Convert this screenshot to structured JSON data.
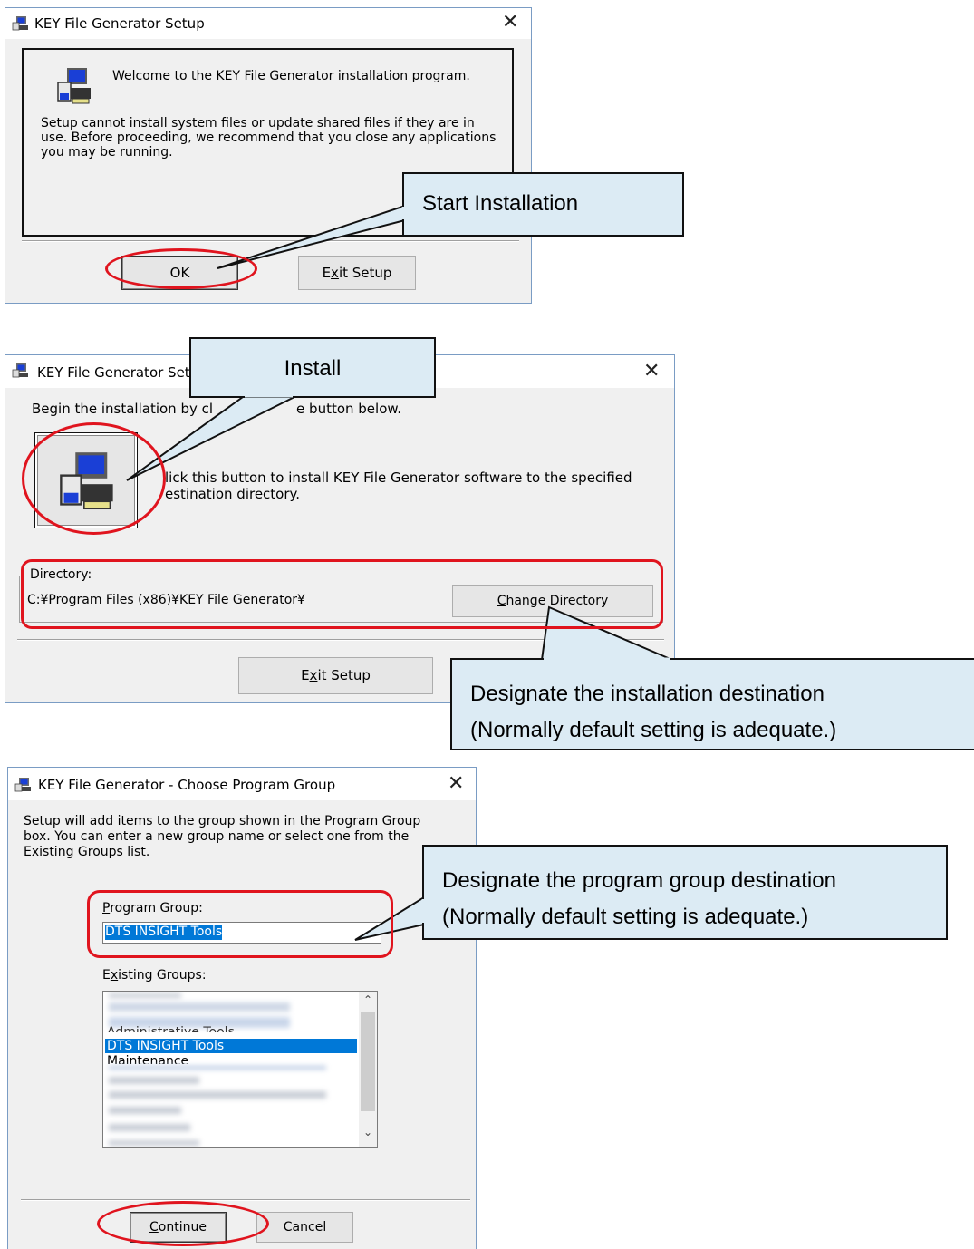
{
  "dialog1": {
    "title": "KEY File Generator Setup",
    "close_glyph": "✕",
    "welcome": "Welcome to the KEY File Generator installation program.",
    "message_lines": [
      "Setup cannot install system files or update shared files if they are in",
      "use. Before proceeding, we recommend that you close any applications",
      "you may be running."
    ],
    "ok_button": "OK",
    "exit_button_pre": "E",
    "exit_button_mn": "x",
    "exit_button_post": "it Setup",
    "callout": "Start Installation"
  },
  "dialog2": {
    "title": "KEY File Generator Set",
    "close_glyph": "✕",
    "begin_a": "Begin the installation by cl",
    "begin_b": "e button below.",
    "install_desc_lines": [
      "lick this button to install KEY File Generator software to the specified",
      "estination directory."
    ],
    "directory_label": "Directory:",
    "directory_path": "C:¥Program Files (x86)¥KEY File Generator¥",
    "change_dir_mn": "C",
    "change_dir_rest": "hange Directory",
    "exit_button_pre": "E",
    "exit_button_mn": "x",
    "exit_button_post": "it Setup",
    "callout_install": "Install",
    "callout_dest_lines": [
      "Designate the installation destination",
      "(Normally default setting is adequate.)"
    ]
  },
  "dialog3": {
    "title": "KEY File Generator - Choose Program Group",
    "close_glyph": "✕",
    "intro_lines": [
      "Setup will add items to the group shown in the Program Group",
      "box. You can enter a new group name or select one from the",
      "Existing Groups list."
    ],
    "program_group_mn": "P",
    "program_group_rest": "rogram Group:",
    "program_group_value": "DTS INSIGHT Tools",
    "existing_pre": "E",
    "existing_mn": "x",
    "existing_post": "isting Groups:",
    "groups": {
      "partial_top": "Administrative Tools",
      "selected": "DTS INSIGHT Tools",
      "maintenance": "Maintenance"
    },
    "continue_mn": "C",
    "continue_rest": "ontinue",
    "cancel_button": "Cancel",
    "callout_lines": [
      "Designate the program group destination",
      "(Normally default setting is adequate.)"
    ]
  },
  "colors": {
    "highlight_red": "#e0141e",
    "callout_fill": "#dcebf4",
    "selection_blue": "#0078d7"
  }
}
